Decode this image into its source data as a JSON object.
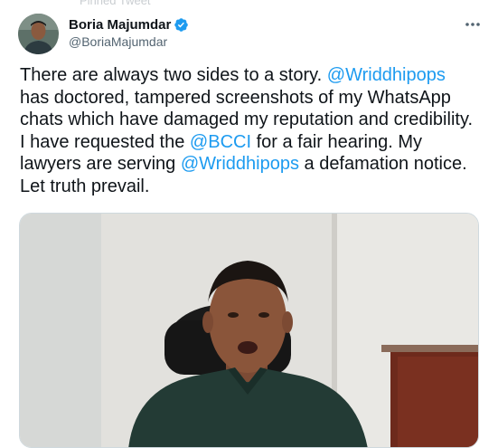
{
  "pinned": {
    "label": "Pinned Tweet"
  },
  "author": {
    "display_name": "Boria Majumdar",
    "handle": "@BoriaMajumdar",
    "verified": true
  },
  "menu": {
    "icon": "more-horizontal-icon"
  },
  "tweet": {
    "segments": [
      {
        "text": "There are always two sides to a story. ",
        "type": "text"
      },
      {
        "text": "@Wriddhipops",
        "type": "mention"
      },
      {
        "text": " has doctored, tampered screenshots of my WhatsApp chats which have damaged my reputation and credibility. I have requested the ",
        "type": "text"
      },
      {
        "text": "@BCCI",
        "type": "mention"
      },
      {
        "text": " for a fair hearing. My lawyers are serving ",
        "type": "text"
      },
      {
        "text": "@Wriddhipops",
        "type": "mention"
      },
      {
        "text": " a defamation notice. Let truth prevail.",
        "type": "text"
      }
    ]
  },
  "colors": {
    "mention": "#1d9bf0",
    "text": "#0f1419",
    "secondary": "#536471",
    "verified": "#1d9bf0"
  }
}
